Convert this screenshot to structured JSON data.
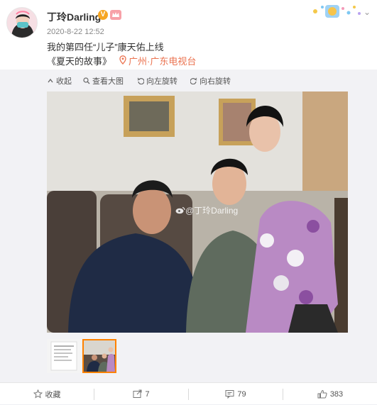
{
  "post": {
    "username": "丁玲Darling",
    "vip_badge": "V",
    "time": "2020-8-22 12:52",
    "text": "我的第四任“儿子”康天佑上线",
    "topic": "《夏天的故事》",
    "location": "广州·广东电视台"
  },
  "toolbar": {
    "collapse": "收起",
    "view_large": "查看大图",
    "rotate_left": "向左旋转",
    "rotate_right": "向右旋转"
  },
  "photo": {
    "watermark": "@丁玲Darling"
  },
  "actions": {
    "favorite": "收藏",
    "repost_count": "7",
    "comment_count": "79",
    "like_count": "383"
  },
  "colors": {
    "accent": "#ff8200",
    "location": "#eb7350",
    "text": "#333333",
    "muted": "#888888"
  }
}
